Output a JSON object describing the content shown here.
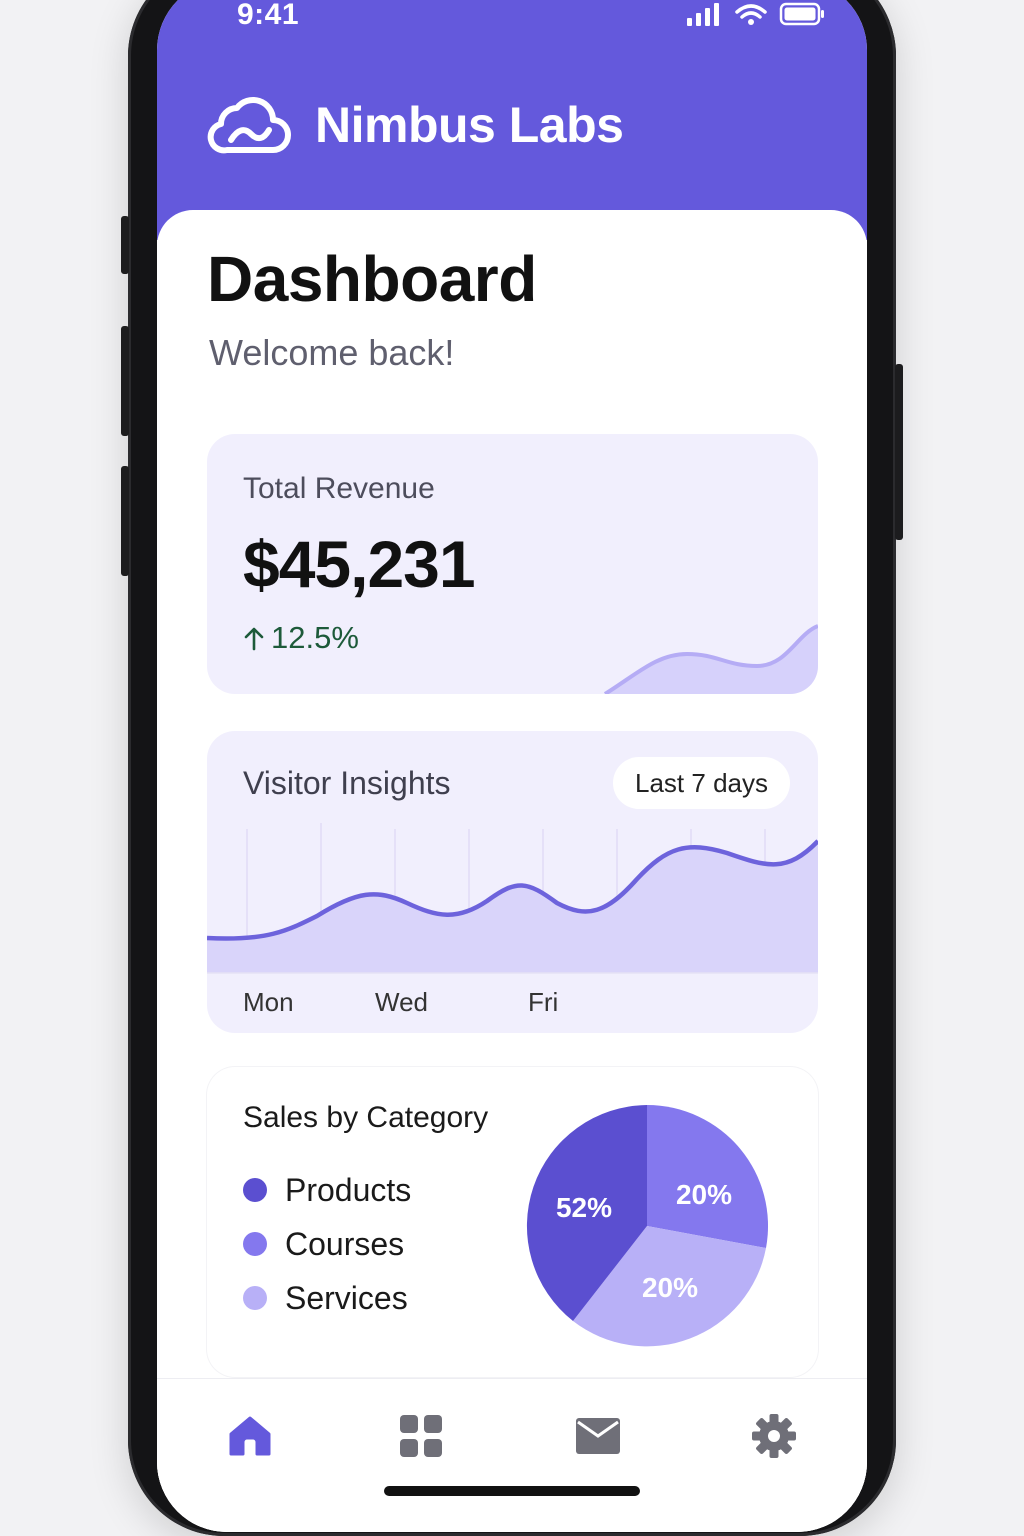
{
  "status": {
    "time": "9:41"
  },
  "brand": {
    "name": "Nimbus Labs"
  },
  "page": {
    "title": "Dashboard",
    "subtitle": "Welcome back!"
  },
  "revenue": {
    "label": "Total Revenue",
    "value": "$45,231",
    "change": "12.5%"
  },
  "visitors": {
    "title": "Visitor Insights",
    "range": "Last 7 days",
    "days": [
      "Mon",
      "Wed",
      "Fri"
    ]
  },
  "sales": {
    "title": "Sales by Category",
    "legend": [
      {
        "label": "Products",
        "color": "#5b4fd0"
      },
      {
        "label": "Courses",
        "color": "#8478ee"
      },
      {
        "label": "Services",
        "color": "#b8b0f7"
      }
    ],
    "slices": [
      {
        "label": "52%",
        "value": 52,
        "color": "#5b4fd0"
      },
      {
        "label": "20%",
        "value": 20,
        "color": "#8478ee"
      },
      {
        "label": "20%",
        "value": 20,
        "color": "#b8b0f7"
      }
    ]
  },
  "tabs": [
    "home-icon",
    "grid-icon",
    "mail-icon",
    "gear-icon"
  ],
  "colors": {
    "accent": "#6459dc",
    "active_tab": "#6459dc",
    "inactive_tab": "#6f6f78"
  }
}
